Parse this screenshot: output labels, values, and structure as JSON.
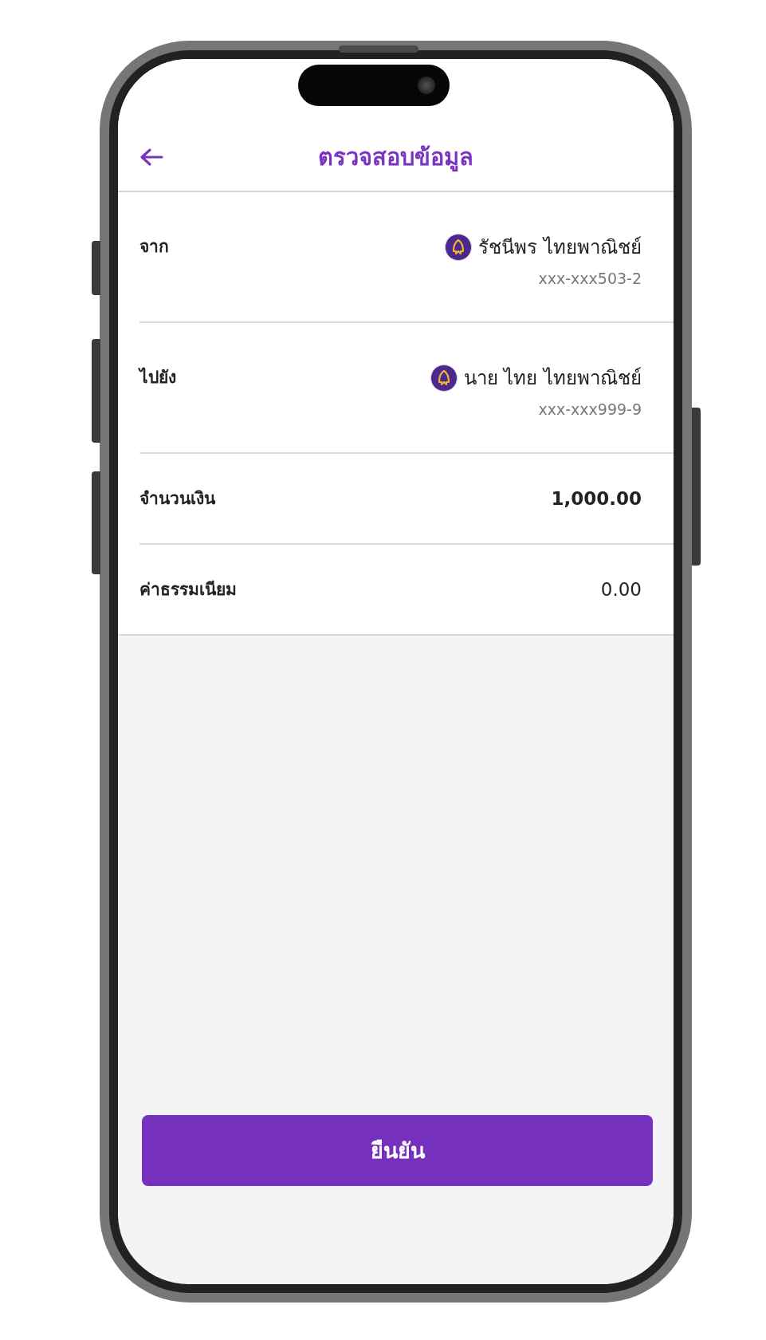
{
  "header": {
    "title": "ตรวจสอบข้อมูล"
  },
  "rows": [
    {
      "kind": "account",
      "label": "จาก",
      "name": "รัชนีพร ไทยพาณิชย์",
      "account": "xxx-xxx503-2"
    },
    {
      "kind": "account",
      "label": "ไปยัง",
      "name": "นาย ไทย ไทยพาณิชย์",
      "account": "xxx-xxx999-9"
    },
    {
      "kind": "amount",
      "label": "จำนวนเงิน",
      "value": "1,000.00"
    },
    {
      "kind": "fee",
      "label": "ค่าธรรมเนียม",
      "value": "0.00"
    }
  ],
  "confirm_button": "ยืนยัน"
}
